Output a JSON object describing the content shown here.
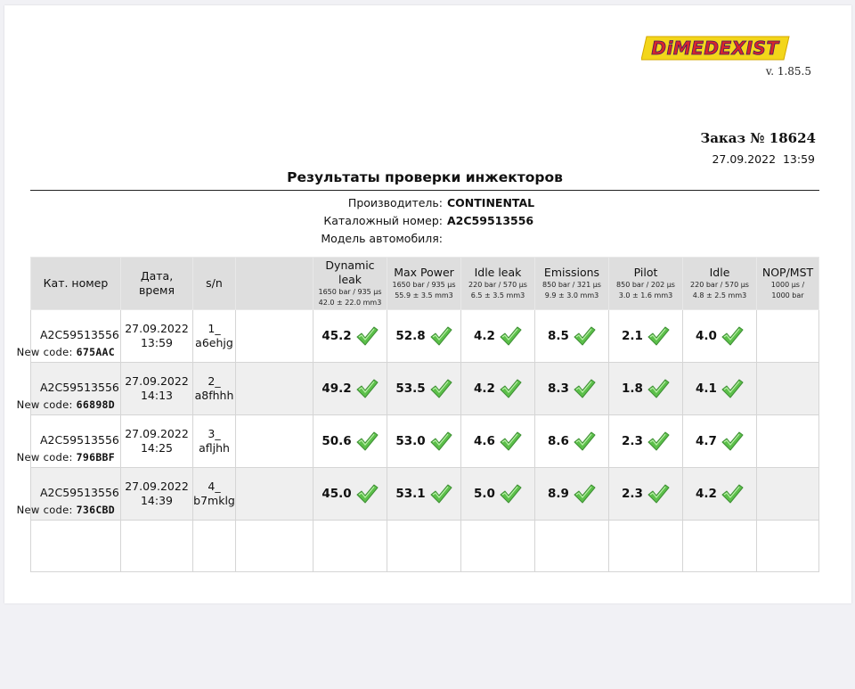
{
  "header": {
    "logo_text": "DiMEDEXIST",
    "version": "v. 1.85.5",
    "order_title": "Заказ № 18624",
    "order_date": "27.09.2022  13:59",
    "title": "Результаты проверки инжекторов"
  },
  "info": {
    "manufacturer_label": "Производитель:",
    "manufacturer_value": "CONTINENTAL",
    "catalog_label": "Каталожный номер:",
    "catalog_value": "A2C59513556",
    "model_label": "Модель автомобиля:",
    "model_value": ""
  },
  "table": {
    "col_part": "Кат. номер",
    "col_date_1": "Дата,",
    "col_date_2": "время",
    "col_sn": "s/n",
    "tests": [
      {
        "name": "Dynamic leak",
        "sub1": "1650 bar / 935 µs",
        "sub2": "42.0 ± 22.0 mm3"
      },
      {
        "name": "Max Power",
        "sub1": "1650 bar / 935 µs",
        "sub2": "55.9 ± 3.5 mm3"
      },
      {
        "name": "Idle leak",
        "sub1": "220 bar / 570 µs",
        "sub2": "6.5 ± 3.5 mm3"
      },
      {
        "name": "Emissions",
        "sub1": "850 bar / 321 µs",
        "sub2": "9.9 ± 3.0 mm3"
      },
      {
        "name": "Pilot",
        "sub1": "850 bar / 202 µs",
        "sub2": "3.0 ± 1.6 mm3"
      },
      {
        "name": "Idle",
        "sub1": "220 bar / 570 µs",
        "sub2": "4.8 ± 2.5 mm3"
      },
      {
        "name": "NOP/MST",
        "sub1": "1000 µs /",
        "sub2": "1000 bar"
      }
    ],
    "new_code_label": "New code:",
    "rows": [
      {
        "part": "A2C59513556",
        "date": "27.09.2022",
        "time": "13:59",
        "sn1": "1_",
        "sn2": "a6ehjg",
        "code": "675AAC",
        "v": [
          "45.2",
          "52.8",
          "4.2",
          "8.5",
          "2.1",
          "4.0"
        ]
      },
      {
        "part": "A2C59513556",
        "date": "27.09.2022",
        "time": "14:13",
        "sn1": "2_",
        "sn2": "a8fhhh",
        "code": "66898D",
        "v": [
          "49.2",
          "53.5",
          "4.2",
          "8.3",
          "1.8",
          "4.1"
        ]
      },
      {
        "part": "A2C59513556",
        "date": "27.09.2022",
        "time": "14:25",
        "sn1": "3_",
        "sn2": "afljhh",
        "code": "796BBF",
        "v": [
          "50.6",
          "53.0",
          "4.6",
          "8.6",
          "2.3",
          "4.7"
        ]
      },
      {
        "part": "A2C59513556",
        "date": "27.09.2022",
        "time": "14:39",
        "sn1": "4_",
        "sn2": "b7mklg",
        "code": "736CBD",
        "v": [
          "45.0",
          "53.1",
          "5.0",
          "8.9",
          "2.3",
          "4.2"
        ]
      }
    ],
    "status_icon": "check-icon",
    "pass_color": "#5cc04a"
  }
}
